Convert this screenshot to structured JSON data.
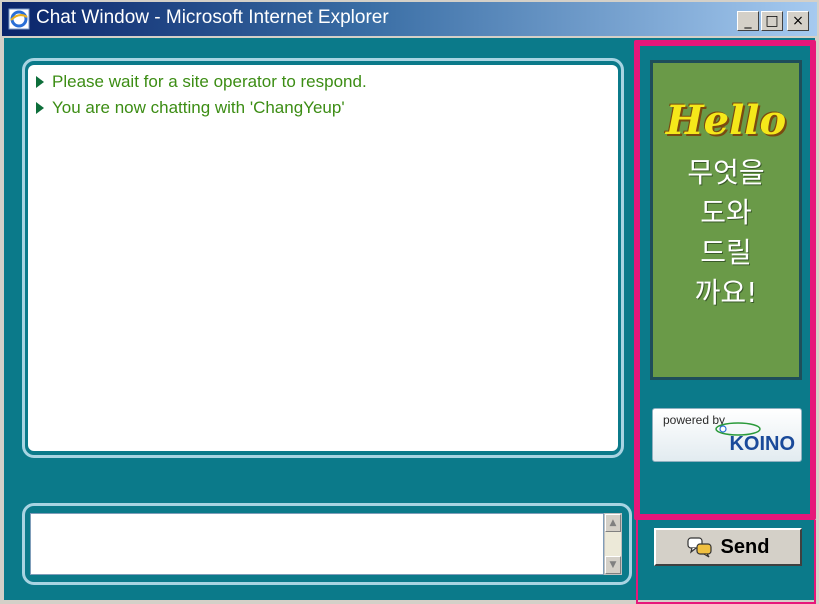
{
  "window": {
    "title": "Chat Window - Microsoft Internet Explorer",
    "minimize_glyph": "_",
    "maximize_glyph": "□",
    "close_glyph": "×"
  },
  "transcript": {
    "messages": [
      "Please wait for a site operator to respond.",
      "You are now chatting with 'ChangYeup'"
    ]
  },
  "input": {
    "value": "",
    "placeholder": ""
  },
  "promo": {
    "hello": "Hello",
    "lines": [
      "무엇을",
      "도와",
      "드릴",
      "까요!"
    ]
  },
  "powered": {
    "by_label": "powered by",
    "brand": "KOINO"
  },
  "send": {
    "label": "Send",
    "icon": "chat-bubbles-icon"
  },
  "colors": {
    "panel": "#0b7a8a",
    "promo_bg": "#6a9a48",
    "highlight": "#e6177a",
    "message_text": "#3c8d14"
  }
}
